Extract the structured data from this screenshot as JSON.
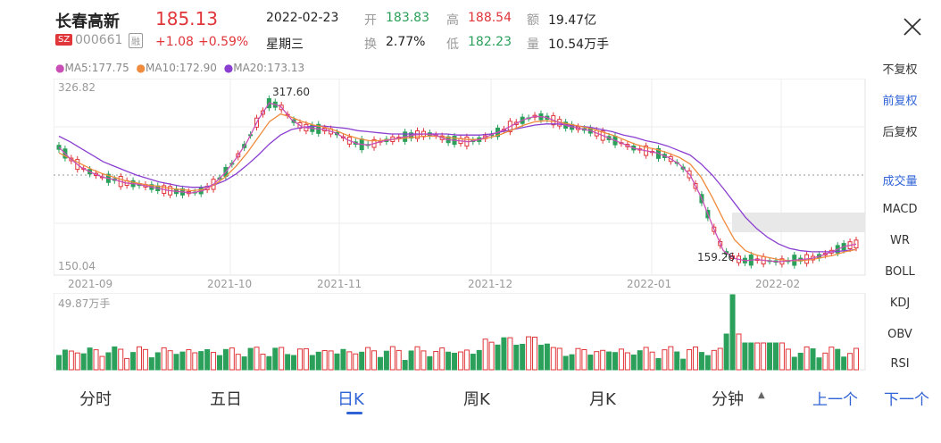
{
  "header": {
    "stock_name": "长春高新",
    "price": "185.13",
    "market_badge": "SZ",
    "code": "000661",
    "margin_badge": "融",
    "change": "+1.08",
    "change_pct": "+0.59%",
    "date": "2022-02-23",
    "weekday": "星期三",
    "stats": [
      {
        "label": "开",
        "value": "183.83",
        "color": "green"
      },
      {
        "label": "高",
        "value": "188.54",
        "color": "red"
      },
      {
        "label": "额",
        "value": "19.47亿",
        "color": "dark"
      },
      {
        "label": "换",
        "value": "2.77%",
        "color": "dark"
      },
      {
        "label": "低",
        "value": "182.23",
        "color": "green"
      },
      {
        "label": "量",
        "value": "10.54万手",
        "color": "dark"
      }
    ]
  },
  "ma_legend": {
    "ma5": "MA5:177.75",
    "ma10": "MA10:172.90",
    "ma20": "MA20:173.13"
  },
  "side_menu": [
    {
      "label": "不复权",
      "active": false
    },
    {
      "label": "前复权",
      "active": true
    },
    {
      "label": "后复权",
      "active": false
    },
    {
      "label": "成交量",
      "active": true
    },
    {
      "label": "MACD",
      "active": false
    },
    {
      "label": "WR",
      "active": false
    },
    {
      "label": "BOLL",
      "active": false
    },
    {
      "label": "KDJ",
      "active": false
    },
    {
      "label": "OBV",
      "active": false
    },
    {
      "label": "RSI",
      "active": false
    }
  ],
  "tabs": {
    "fenshi": "分时",
    "wuri": "五日",
    "rik": "日K",
    "zhouk": "周K",
    "yuek": "月K",
    "fenzhong": "分钟",
    "prev": "上一个",
    "next": "下一个"
  },
  "colors": {
    "up": "#e0363a",
    "down": "#2aa05a",
    "ma5": "#c94fb6",
    "ma10": "#f08a3c",
    "ma20": "#8a3fd1",
    "accent": "#2f63d6"
  },
  "chart_data": {
    "type": "candlestick",
    "y_axis": {
      "max_label": "326.82",
      "min_label": "150.04",
      "ylim": [
        150.04,
        326.82
      ]
    },
    "annotations": {
      "high": "317.60",
      "low": "159.26"
    },
    "x_ticks": [
      "2021-09",
      "2021-10",
      "2021-11",
      "2021-12",
      "2022-01",
      "2022-02"
    ],
    "volume_max_label": "49.87万手",
    "series": [
      {
        "name": "MA5",
        "values": [
          265,
          255,
          247,
          242,
          238,
          236,
          233,
          232,
          230,
          228,
          226,
          225,
          224,
          226,
          232,
          242,
          255,
          270,
          290,
          305,
          302,
          290,
          283,
          282,
          281,
          278,
          272,
          268,
          267,
          270,
          272,
          274,
          276,
          277,
          276,
          272,
          271,
          270,
          272,
          276,
          280,
          285,
          290,
          293,
          292,
          288,
          284,
          282,
          280,
          276,
          272,
          268,
          264,
          262,
          260,
          256,
          250,
          240,
          220,
          195,
          172,
          165,
          163,
          164,
          163,
          162,
          163,
          164,
          165,
          168,
          172,
          176,
          178
        ]
      },
      {
        "name": "MA10",
        "values": [
          260,
          255,
          250,
          245,
          241,
          238,
          235,
          233,
          231,
          230,
          228,
          227,
          226,
          227,
          231,
          238,
          248,
          260,
          274,
          288,
          295,
          292,
          288,
          285,
          283,
          280,
          276,
          273,
          271,
          271,
          272,
          273,
          274,
          275,
          275,
          274,
          273,
          272,
          272,
          274,
          277,
          281,
          285,
          288,
          289,
          288,
          286,
          284,
          282,
          279,
          276,
          272,
          268,
          265,
          263,
          260,
          256,
          250,
          238,
          220,
          200,
          182,
          172,
          168,
          166,
          164,
          163,
          163,
          164,
          166,
          168,
          171,
          173
        ]
      },
      {
        "name": "MA20",
        "values": [
          275,
          270,
          264,
          258,
          252,
          248,
          244,
          240,
          237,
          234,
          232,
          230,
          229,
          229,
          231,
          235,
          241,
          249,
          258,
          268,
          276,
          281,
          283,
          284,
          284,
          283,
          282,
          280,
          279,
          278,
          277,
          277,
          277,
          277,
          277,
          277,
          276,
          276,
          276,
          277,
          279,
          281,
          283,
          285,
          286,
          286,
          285,
          284,
          283,
          281,
          279,
          276,
          274,
          271,
          269,
          266,
          262,
          258,
          250,
          240,
          228,
          215,
          202,
          192,
          184,
          178,
          174,
          172,
          171,
          171,
          171,
          172,
          173
        ]
      }
    ]
  }
}
